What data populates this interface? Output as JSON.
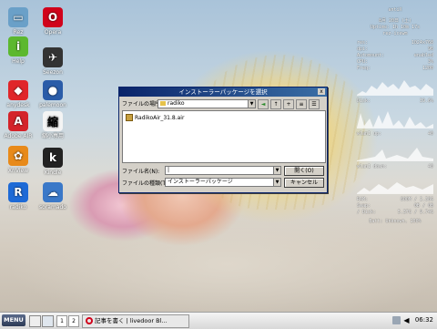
{
  "desktop_icons": [
    {
      "name": "Rez",
      "glyph": "▭",
      "color": "#6aa0c8"
    },
    {
      "name": "Help",
      "glyph": "i",
      "color": "#5cb82f"
    },
    {
      "name": "anydesk",
      "glyph": "◆",
      "color": "#e0262a"
    },
    {
      "name": "Adobe AIR",
      "glyph": "A",
      "color": "#d4232a"
    },
    {
      "name": "XnView",
      "glyph": "✿",
      "color": "#e88a1a"
    },
    {
      "name": "radiko",
      "glyph": "R",
      "color": "#1e6ad6"
    },
    {
      "name": "Opera",
      "glyph": "O",
      "color": "#d0021b"
    },
    {
      "name": "Seezon",
      "glyph": "✈",
      "color": "#333333"
    },
    {
      "name": "palemoon",
      "glyph": "●",
      "color": "#2a5ca8"
    },
    {
      "name": "縮小専用",
      "glyph": "縮",
      "color": "#f4f4f4"
    },
    {
      "name": "Kindle",
      "glyph": "k",
      "color": "#222222"
    },
    {
      "name": "soramado",
      "glyph": "☁",
      "color": "#3a78c8"
    }
  ],
  "conky": {
    "title": "antiX",
    "date": "8月 20日 (土)",
    "uptime": "Uptime: 1h 10m 17s",
    "user": "rez-icewm",
    "rows": [
      [
        "res:",
        "1024x768"
      ],
      [
        "dpi:",
        "96"
      ],
      [
        "Automount:",
        "enabled"
      ],
      [
        "CPU:",
        "3%"
      ],
      [
        "Freq:",
        "1200"
      ]
    ],
    "disk": [
      "Disk:",
      "39.6%"
    ],
    "wlan_up": [
      "wlan1 up:",
      "40"
    ],
    "wlan_down": [
      "wlan1 down:",
      "40"
    ],
    "mem": [
      [
        "RAM:",
        "800M / 2.38G"
      ],
      [
        "Swap:",
        "0B / 0B"
      ],
      [
        "/ Disk:",
        "5.37G / 9.74G"
      ]
    ],
    "batt": "Batt: Unknown, 100%"
  },
  "dialog": {
    "title": "インストーラーパッケージを選択",
    "close": "x",
    "look_in_label": "ファイルの場所(I):",
    "look_in_value": "radiko",
    "files": [
      "RadikoAir_31.8.air"
    ],
    "filename_label": "ファイル名(N):",
    "filename_value": "|",
    "filetype_label": "ファイルの種類(T):",
    "filetype_value": "インストーラーパッケージ",
    "open_button": "開く(O)",
    "cancel_button": "キャンセル"
  },
  "taskbar": {
    "menu_label": "MENU",
    "workspaces": [
      "1",
      "2"
    ],
    "task_label": "記事を書く | livedoor Bl...",
    "clock": "06:32"
  },
  "colors": {
    "title_start": "#0a246a",
    "title_end": "#3a6ea5"
  }
}
